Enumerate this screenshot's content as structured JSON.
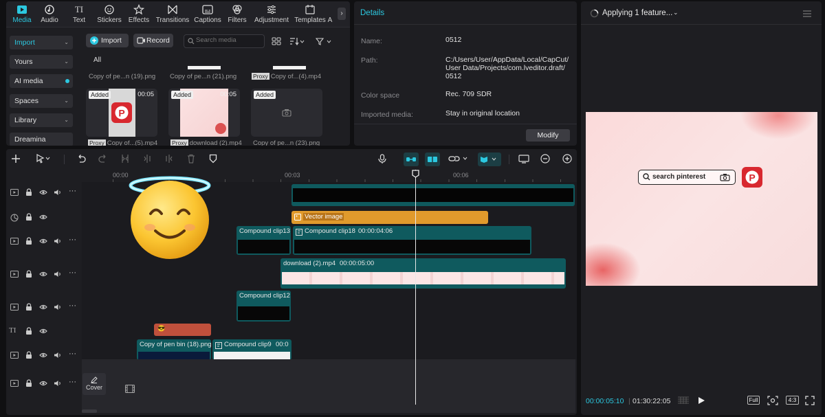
{
  "toolbar": {
    "tabs": [
      {
        "label": "Media",
        "icon": "media-icon"
      },
      {
        "label": "Audio",
        "icon": "audio-icon"
      },
      {
        "label": "Text",
        "icon": "text-icon"
      },
      {
        "label": "Stickers",
        "icon": "stickers-icon"
      },
      {
        "label": "Effects",
        "icon": "effects-icon"
      },
      {
        "label": "Transitions",
        "icon": "transitions-icon"
      },
      {
        "label": "Captions",
        "icon": "captions-icon"
      },
      {
        "label": "Filters",
        "icon": "filters-icon"
      },
      {
        "label": "Adjustment",
        "icon": "adjustment-icon"
      },
      {
        "label": "Templates",
        "icon": "templates-icon"
      },
      {
        "label": "A",
        "icon": "ai-icon"
      }
    ]
  },
  "media": {
    "sidebar": [
      "Import",
      "Yours",
      "AI media",
      "Spaces",
      "Library",
      "Dreamina"
    ],
    "import_label": "Import",
    "record_label": "Record",
    "search_placeholder": "Search media",
    "all_label": "All",
    "top_captions": [
      "Copy of pe...n (19).png",
      "Copy of pe...n (21).png",
      "Copy of...(4).mp4"
    ],
    "proxy_label": "Proxy",
    "added_label": "Added",
    "items": [
      {
        "duration": "00:05",
        "caption": "Copy of...(5).mp4",
        "proxy": true
      },
      {
        "duration": "00:05",
        "caption": "download (2).mp4",
        "proxy": true
      },
      {
        "duration": "",
        "caption": "Copy of pe...n (23).png",
        "proxy": false
      }
    ]
  },
  "details": {
    "title": "Details",
    "rows": [
      {
        "key": "Name:",
        "value": "0512"
      },
      {
        "key": "Path:",
        "value": "C:/Users/User/AppData/Local/CapCut/ User Data/Projects/com.lveditor.draft/ 0512"
      },
      {
        "key": "Color space",
        "value": "Rec. 709 SDR"
      },
      {
        "key": "Imported media:",
        "value": "Stay in original location"
      }
    ],
    "modify_label": "Modify"
  },
  "player": {
    "title": "Applying 1 feature...",
    "search_text": "search pinterest",
    "current_time": "00:00:05:10",
    "total_time": "01:30:22:05",
    "full_label": "Full",
    "ratio_label": "4:3"
  },
  "timeline": {
    "ruler": [
      "00:00",
      "00:03",
      "00:06"
    ],
    "clips": {
      "vector": "Vector image",
      "compound13": "Compound clip13",
      "compound18": "Compound clip18",
      "compound18_dur": "00:00:04:06",
      "download": "download (2).mp4",
      "download_dur": "00:00:05:00",
      "compound12": "Compound clip12",
      "penbin": "Copy of pen bin (18).png",
      "compound9": "Compound clip9",
      "compound9_dur": "00:0"
    },
    "cover_label": "Cover"
  },
  "colors": {
    "accent": "#2cc8e0",
    "clip_teal": "#0f5a5e",
    "clip_orange": "#e09a2c",
    "clip_red": "#c0503c"
  }
}
